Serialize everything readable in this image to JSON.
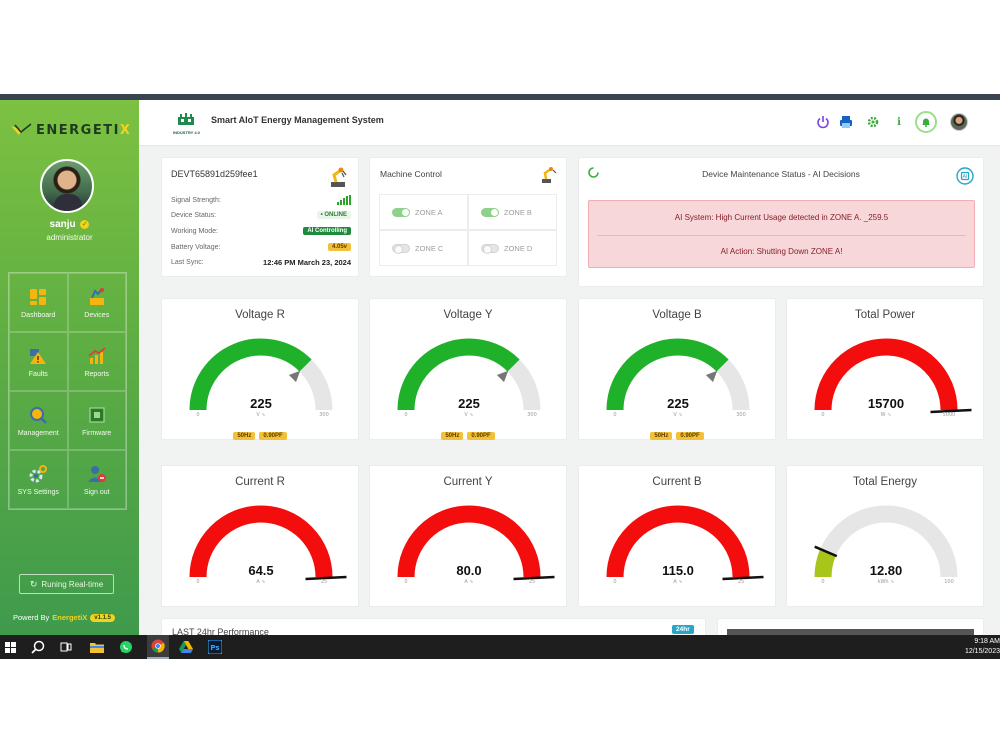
{
  "app": {
    "title": "Smart AIoT Energy Management System",
    "brand": "ENERGETIX",
    "brand_prefix": "ENERGETI",
    "brand_suffix": "X",
    "header_logo_caption": "INDUSTRY 4.0"
  },
  "user": {
    "name": "sanju",
    "role": "administrator"
  },
  "sidebar": {
    "items": [
      {
        "label": "Dashboard",
        "icon": "dashboard-icon"
      },
      {
        "label": "Devices",
        "icon": "devices-icon"
      },
      {
        "label": "Faults",
        "icon": "faults-icon"
      },
      {
        "label": "Reports",
        "icon": "reports-icon"
      },
      {
        "label": "Management",
        "icon": "management-icon"
      },
      {
        "label": "Firmware",
        "icon": "firmware-icon"
      },
      {
        "label": "SYS Settings",
        "icon": "settings-icon"
      },
      {
        "label": "Sign out",
        "icon": "signout-icon"
      }
    ],
    "running_label": "Runing Real-time",
    "powered_prefix": "Powerd By",
    "powered_brand": "EnergetiX",
    "version": "v1.1.5"
  },
  "device": {
    "id": "DEVT65891d259fee1",
    "rows": [
      {
        "key": "Signal Strength:",
        "value": ""
      },
      {
        "key": "Device Status:",
        "value": "• ONLINE"
      },
      {
        "key": "Working Mode:",
        "value": "AI Controlling"
      },
      {
        "key": "Battery Voltage:",
        "value": "4.05v"
      },
      {
        "key": "Last Sync:",
        "value": "12:46 PM March 23, 2024"
      }
    ]
  },
  "machine_control": {
    "title": "Machine Control",
    "zones": [
      {
        "label": "ZONE A",
        "on": true
      },
      {
        "label": "ZONE B",
        "on": true
      },
      {
        "label": "ZONE C",
        "on": false
      },
      {
        "label": "ZONE D",
        "on": false
      }
    ]
  },
  "maintenance": {
    "title": "Device Maintenance Status - AI Decisions",
    "alert_line1": "AI System: High Current Usage detected in ZONE A.    _259.5",
    "alert_line2": "AI Action: Shutting Down ZONE A!"
  },
  "gauges": [
    {
      "title": "Voltage R",
      "value": 225,
      "display": "225",
      "min": 0,
      "max": 300,
      "min_label": "0",
      "max_label": "300",
      "unit": "V ∿",
      "color": "#1fb12a",
      "freq": "50Hz",
      "pf": "0.90PF",
      "show_badges": true
    },
    {
      "title": "Voltage Y",
      "value": 225,
      "display": "225",
      "min": 0,
      "max": 300,
      "min_label": "0",
      "max_label": "300",
      "unit": "V ∿",
      "color": "#1fb12a",
      "freq": "50Hz",
      "pf": "0.90PF",
      "show_badges": true
    },
    {
      "title": "Voltage B",
      "value": 225,
      "display": "225",
      "min": 0,
      "max": 300,
      "min_label": "0",
      "max_label": "300",
      "unit": "V ∿",
      "color": "#1fb12a",
      "freq": "50Hz",
      "pf": "0.90PF",
      "show_badges": true
    },
    {
      "title": "Total Power",
      "value": 15700,
      "display": "15700",
      "min": 0,
      "max": 5000,
      "min_label": "0",
      "max_label": "5000",
      "unit": "W ∿",
      "color": "#f40d0d",
      "show_badges": false
    },
    {
      "title": "Current R",
      "value": 64.5,
      "display": "64.5",
      "min": 0,
      "max": 25,
      "min_label": "0",
      "max_label": "25",
      "unit": "A ∿",
      "color": "#f40d0d",
      "show_badges": false
    },
    {
      "title": "Current Y",
      "value": 80.0,
      "display": "80.0",
      "min": 0,
      "max": 25,
      "min_label": "0",
      "max_label": "25",
      "unit": "A ∿",
      "color": "#f40d0d",
      "show_badges": false
    },
    {
      "title": "Current B",
      "value": 115.0,
      "display": "115.0",
      "min": 0,
      "max": 25,
      "min_label": "0",
      "max_label": "25",
      "unit": "A ∿",
      "color": "#f40d0d",
      "show_badges": false
    },
    {
      "title": "Total Energy",
      "value": 12.8,
      "display": "12.80",
      "min": 0,
      "max": 100,
      "min_label": "0",
      "max_label": "100",
      "unit": "kWh ∿",
      "color": "#a8c51a",
      "show_badges": false
    }
  ],
  "performance": {
    "title": "LAST 24hr Performance",
    "badge": "24hr"
  },
  "taskbar": {
    "time": "9:18 AM",
    "date": "12/15/2023"
  },
  "colors": {
    "sidebar_top": "#7cc142",
    "sidebar_bottom": "#3f9a4c",
    "gauge_track": "#e6e6e6",
    "alert_bg": "#f8d7da",
    "alert_text": "#842029",
    "badge_yellow": "#f4c037"
  }
}
